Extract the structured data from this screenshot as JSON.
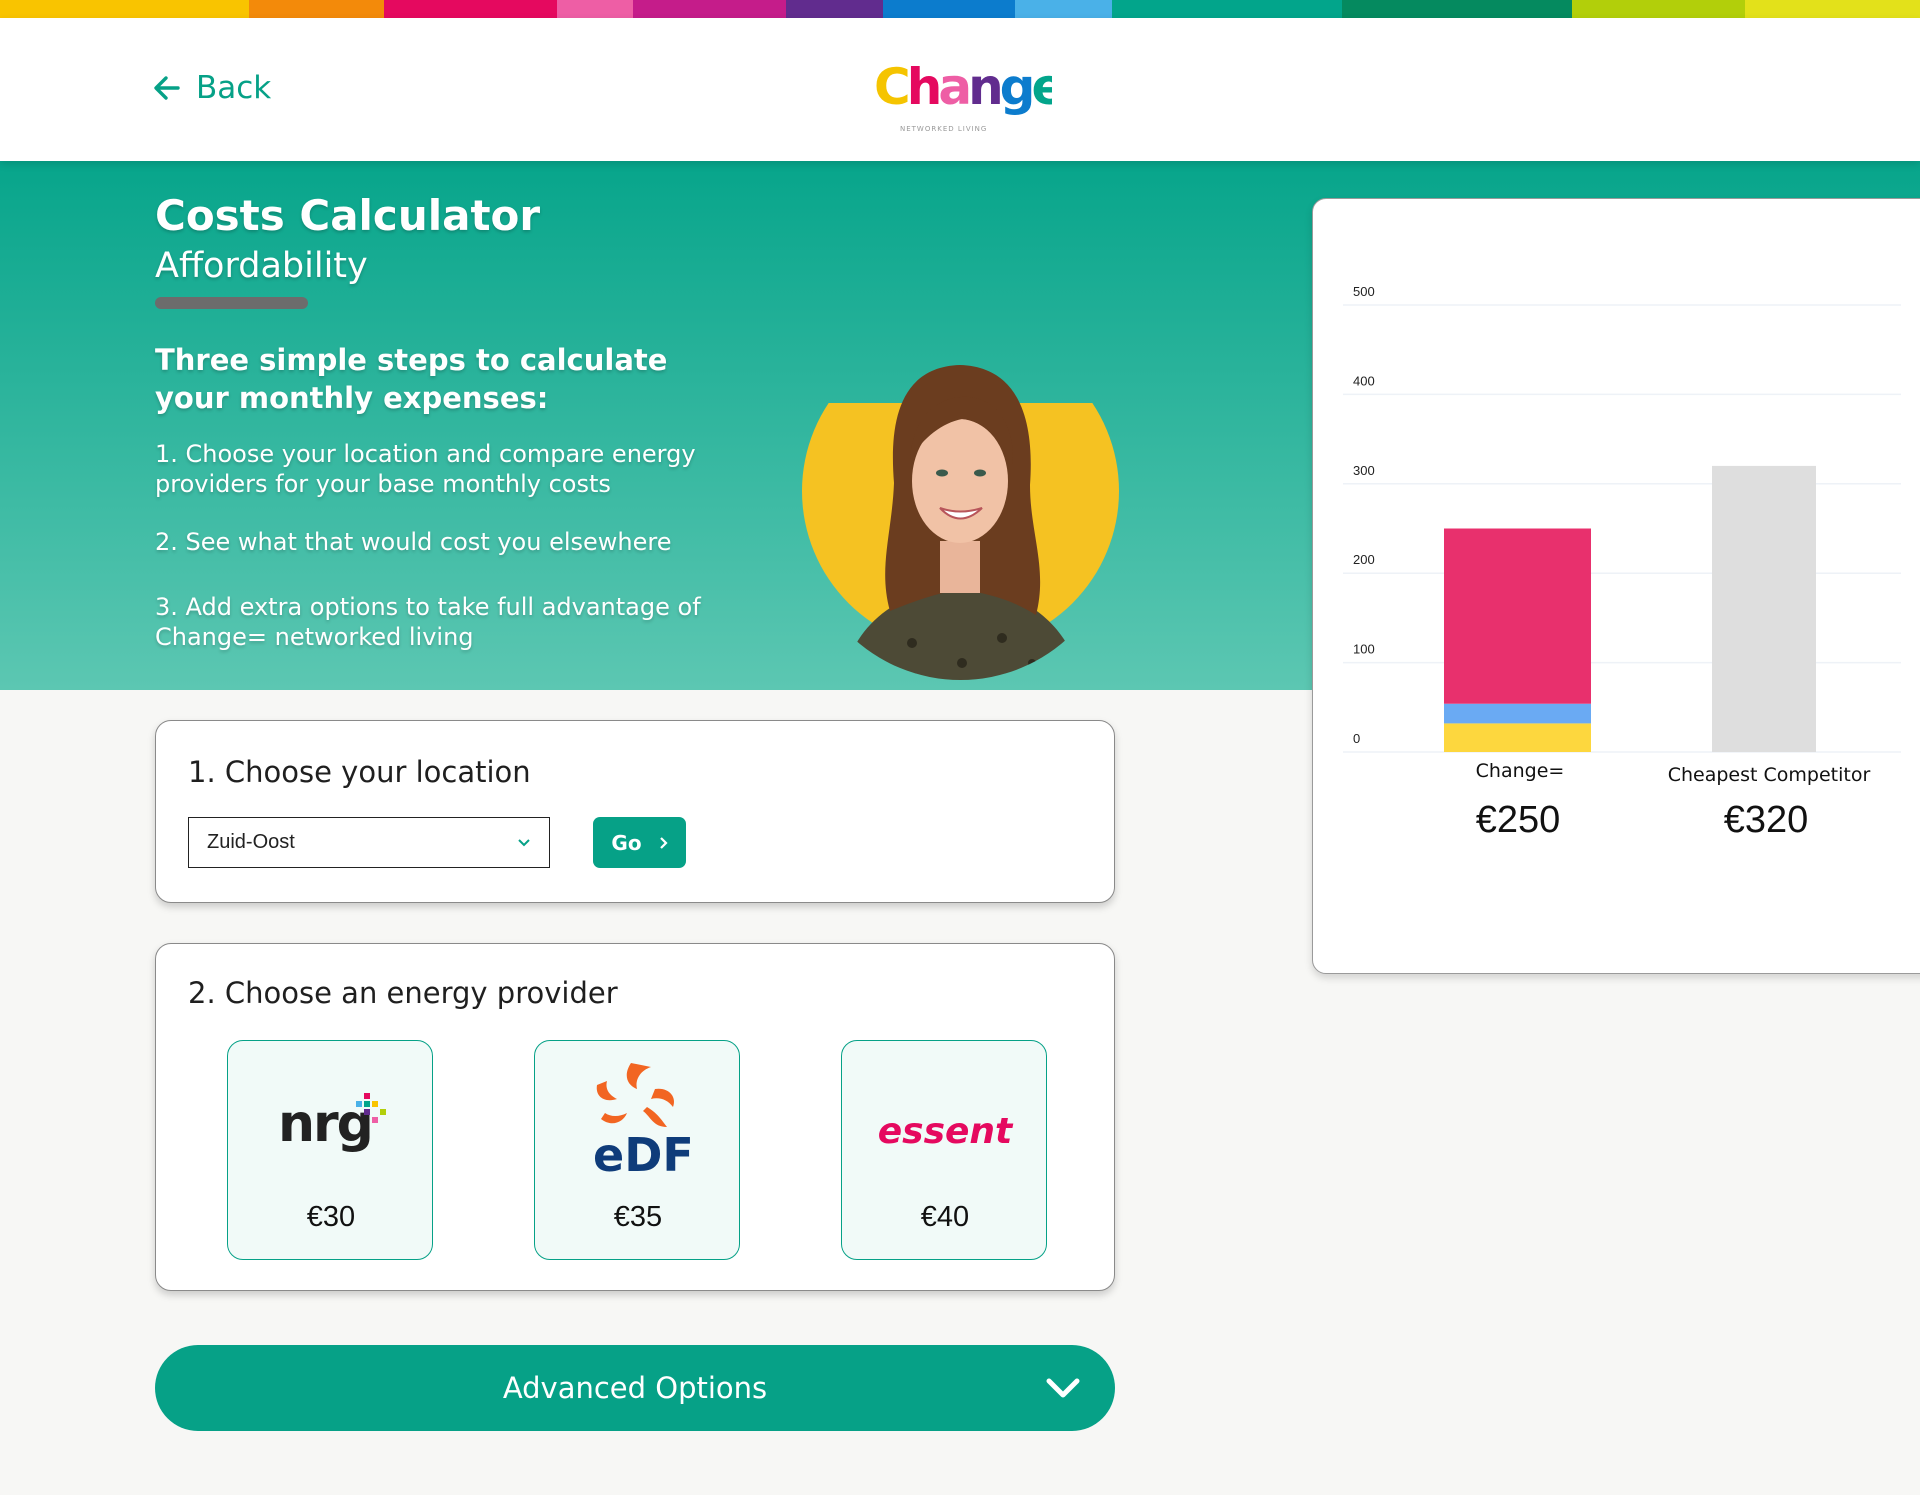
{
  "header": {
    "back_label": "Back",
    "logo_text": "Change=",
    "logo_tagline": "NETWORKED LIVING"
  },
  "rainbow_colors": [
    "#f9c400",
    "#f38a0a",
    "#e5095f",
    "#ee5ea5",
    "#c51c8a",
    "#612c8e",
    "#0c7ccd",
    "#4ab1e8",
    "#02a58b",
    "#058a5f",
    "#b2cf0a",
    "#e3e11a"
  ],
  "hero": {
    "title": "Costs Calculator",
    "subtitle": "Affordability",
    "steps_heading": "Three simple steps to calculate your monthly expenses:",
    "steps": [
      "1. Choose your location and compare energy providers for your base monthly costs",
      "2. See what that would cost you elsewhere",
      "3. Add extra options to take full advantage of Change= networked living"
    ]
  },
  "location": {
    "title": "1. Choose your location",
    "selected": "Zuid-Oost",
    "go_label": "Go"
  },
  "providers": {
    "title": "2. Choose an energy provider",
    "items": [
      {
        "name": "nrg",
        "price": "€30"
      },
      {
        "name": "EDF",
        "price": "€35"
      },
      {
        "name": "essent",
        "price": "€40"
      }
    ]
  },
  "advanced": {
    "label": "Advanced Options"
  },
  "summary": {
    "change_label": "Change=",
    "change_amount": "€250",
    "competitor_label": "Cheapest Competitor",
    "competitor_amount": "€320"
  },
  "colors": {
    "accent": "#06a187",
    "change_main": "#e8306d",
    "change_blue": "#6aaaf3",
    "change_yellow": "#fdd73e",
    "competitor": "#dedede"
  },
  "chart_data": {
    "type": "bar",
    "stacked": true,
    "categories": [
      "Change=",
      "Cheapest Competitor"
    ],
    "series": [
      {
        "values": [
          32,
          0
        ],
        "color": "#fdd73e"
      },
      {
        "values": [
          22,
          0
        ],
        "color": "#6aaaf3"
      },
      {
        "values": [
          196,
          320
        ],
        "color": "#e8306d"
      }
    ],
    "yticks": [
      0,
      100,
      200,
      300,
      400,
      500
    ],
    "ylim": [
      0,
      500
    ],
    "grid": true
  }
}
